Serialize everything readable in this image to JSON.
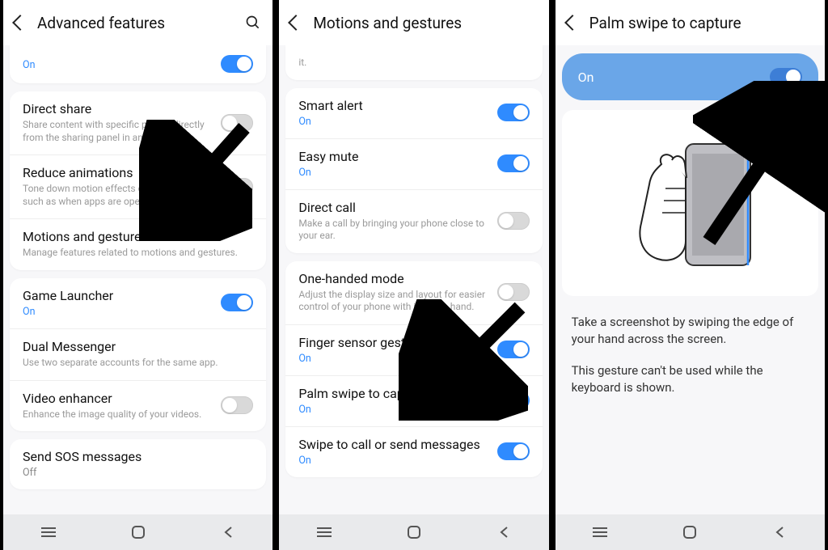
{
  "panel1": {
    "title": "Advanced features",
    "truncated_status": "On",
    "items": [
      {
        "title": "Direct share",
        "desc": "Share content with specific people directly from the sharing panel in any app.",
        "toggle": "off"
      },
      {
        "title": "Reduce animations",
        "desc": "Tone down motion effects on the screen, such as when apps are opened or closed.",
        "toggle": "off"
      },
      {
        "title": "Motions and gestures",
        "desc": "Manage features related to motions and gestures."
      }
    ],
    "group2": [
      {
        "title": "Game Launcher",
        "status": "On",
        "toggle": "on"
      },
      {
        "title": "Dual Messenger",
        "desc": "Use two separate accounts for the same app."
      },
      {
        "title": "Video enhancer",
        "desc": "Enhance the image quality of your videos.",
        "toggle": "off"
      }
    ],
    "group3": [
      {
        "title": "Send SOS messages",
        "status": "Off"
      }
    ]
  },
  "panel2": {
    "title": "Motions and gestures",
    "truncated_tail": "it.",
    "group1": [
      {
        "title": "Smart alert",
        "status": "On",
        "toggle": "on"
      },
      {
        "title": "Easy mute",
        "status": "On",
        "toggle": "on"
      },
      {
        "title": "Direct call",
        "desc": "Make a call by bringing your phone close to your ear.",
        "toggle": "off"
      }
    ],
    "group2": [
      {
        "title": "One-handed mode",
        "desc": "Adjust the display size and layout for easier control of your phone with just one hand.",
        "toggle": "off"
      },
      {
        "title": "Finger sensor gestures",
        "status": "On",
        "toggle": "on"
      },
      {
        "title": "Palm swipe to capture",
        "status": "On",
        "toggle": "on"
      },
      {
        "title": "Swipe to call or send messages",
        "status": "On",
        "toggle": "on"
      }
    ]
  },
  "panel3": {
    "title": "Palm swipe to capture",
    "switch_label": "On",
    "desc1": "Take a screenshot by swiping the edge of your hand across the screen.",
    "desc2": "This gesture can't be used while the keyboard is shown."
  }
}
